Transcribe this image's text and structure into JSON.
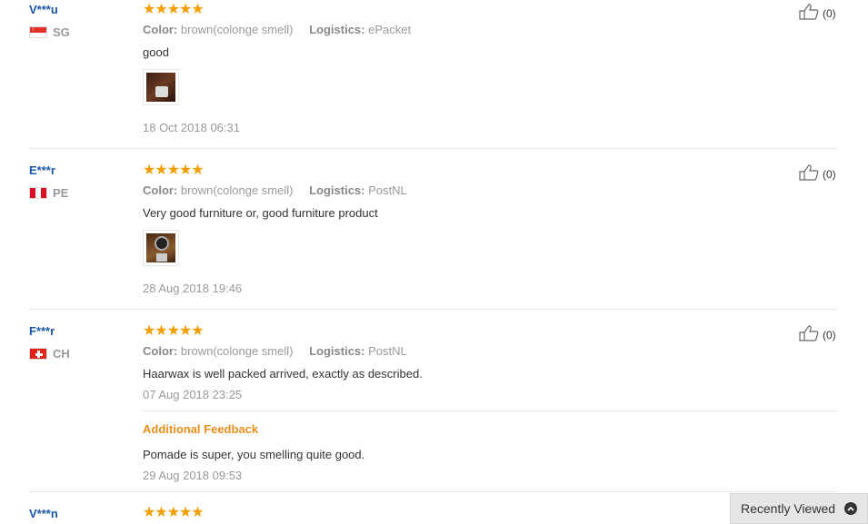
{
  "reviews": [
    {
      "user": "V***u",
      "country": "SG",
      "stars": "★★★★★",
      "color_label": "Color:",
      "color_value": "brown(colonge smell)",
      "logistics_label": "Logistics:",
      "logistics_value": "ePacket",
      "text": "good",
      "date": "18 Oct 2018 06:31",
      "helpful": "(0)"
    },
    {
      "user": "E***r",
      "country": "PE",
      "stars": "★★★★★",
      "color_label": "Color:",
      "color_value": "brown(colonge smell)",
      "logistics_label": "Logistics:",
      "logistics_value": "PostNL",
      "text": "Very good furniture or, good furniture product",
      "date": "28 Aug 2018 19:46",
      "helpful": "(0)"
    },
    {
      "user": "F***r",
      "country": "CH",
      "stars": "★★★★★",
      "color_label": "Color:",
      "color_value": "brown(colonge smell)",
      "logistics_label": "Logistics:",
      "logistics_value": "PostNL",
      "text": "Haarwax is well packed arrived, exactly as described.",
      "date": "07 Aug 2018 23:25",
      "helpful": "(0)",
      "additional_title": "Additional Feedback",
      "additional_text": "Pomade is super, you smelling quite good.",
      "additional_date": "29 Aug 2018 09:53"
    },
    {
      "user": "V***n",
      "stars": "★★★★★"
    }
  ],
  "recently_viewed": "Recently Viewed",
  "icons": {
    "thumb": "thumbs-up-icon",
    "chevron": "chevron-up-icon"
  },
  "colors": {
    "accent_orange": "#f59e00",
    "user_blue": "#1a56a6",
    "feedback_orange": "#e9901c"
  }
}
